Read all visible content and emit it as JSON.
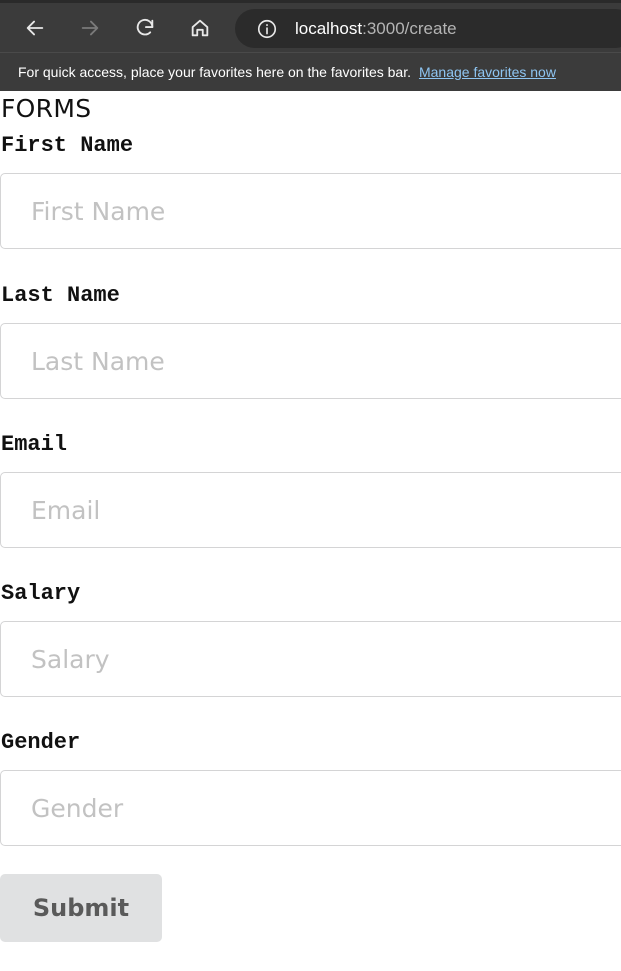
{
  "browser": {
    "url_host": "localhost",
    "url_path": ":3000/create",
    "favorites_message": "For quick access, place your favorites here on the favorites bar.",
    "favorites_link": "Manage favorites now"
  },
  "form": {
    "title": "FORMS",
    "fields": [
      {
        "label": "First Name",
        "placeholder": "First Name",
        "value": ""
      },
      {
        "label": "Last Name",
        "placeholder": "Last Name",
        "value": ""
      },
      {
        "label": "Email",
        "placeholder": "Email",
        "value": ""
      },
      {
        "label": "Salary",
        "placeholder": "Salary",
        "value": ""
      },
      {
        "label": "Gender",
        "placeholder": "Gender",
        "value": ""
      }
    ],
    "submit_label": "Submit"
  },
  "icons": {
    "back": "arrow-left-icon",
    "forward": "arrow-right-icon",
    "refresh": "refresh-icon",
    "home": "home-icon",
    "info": "info-icon"
  },
  "colors": {
    "chrome_bg": "#3b3b3b",
    "address_bg": "#2b2b2b",
    "link": "#8ec5f2",
    "button_bg": "#e0e1e2",
    "input_border": "#d4d4d5",
    "placeholder": "#c2c2c2"
  }
}
